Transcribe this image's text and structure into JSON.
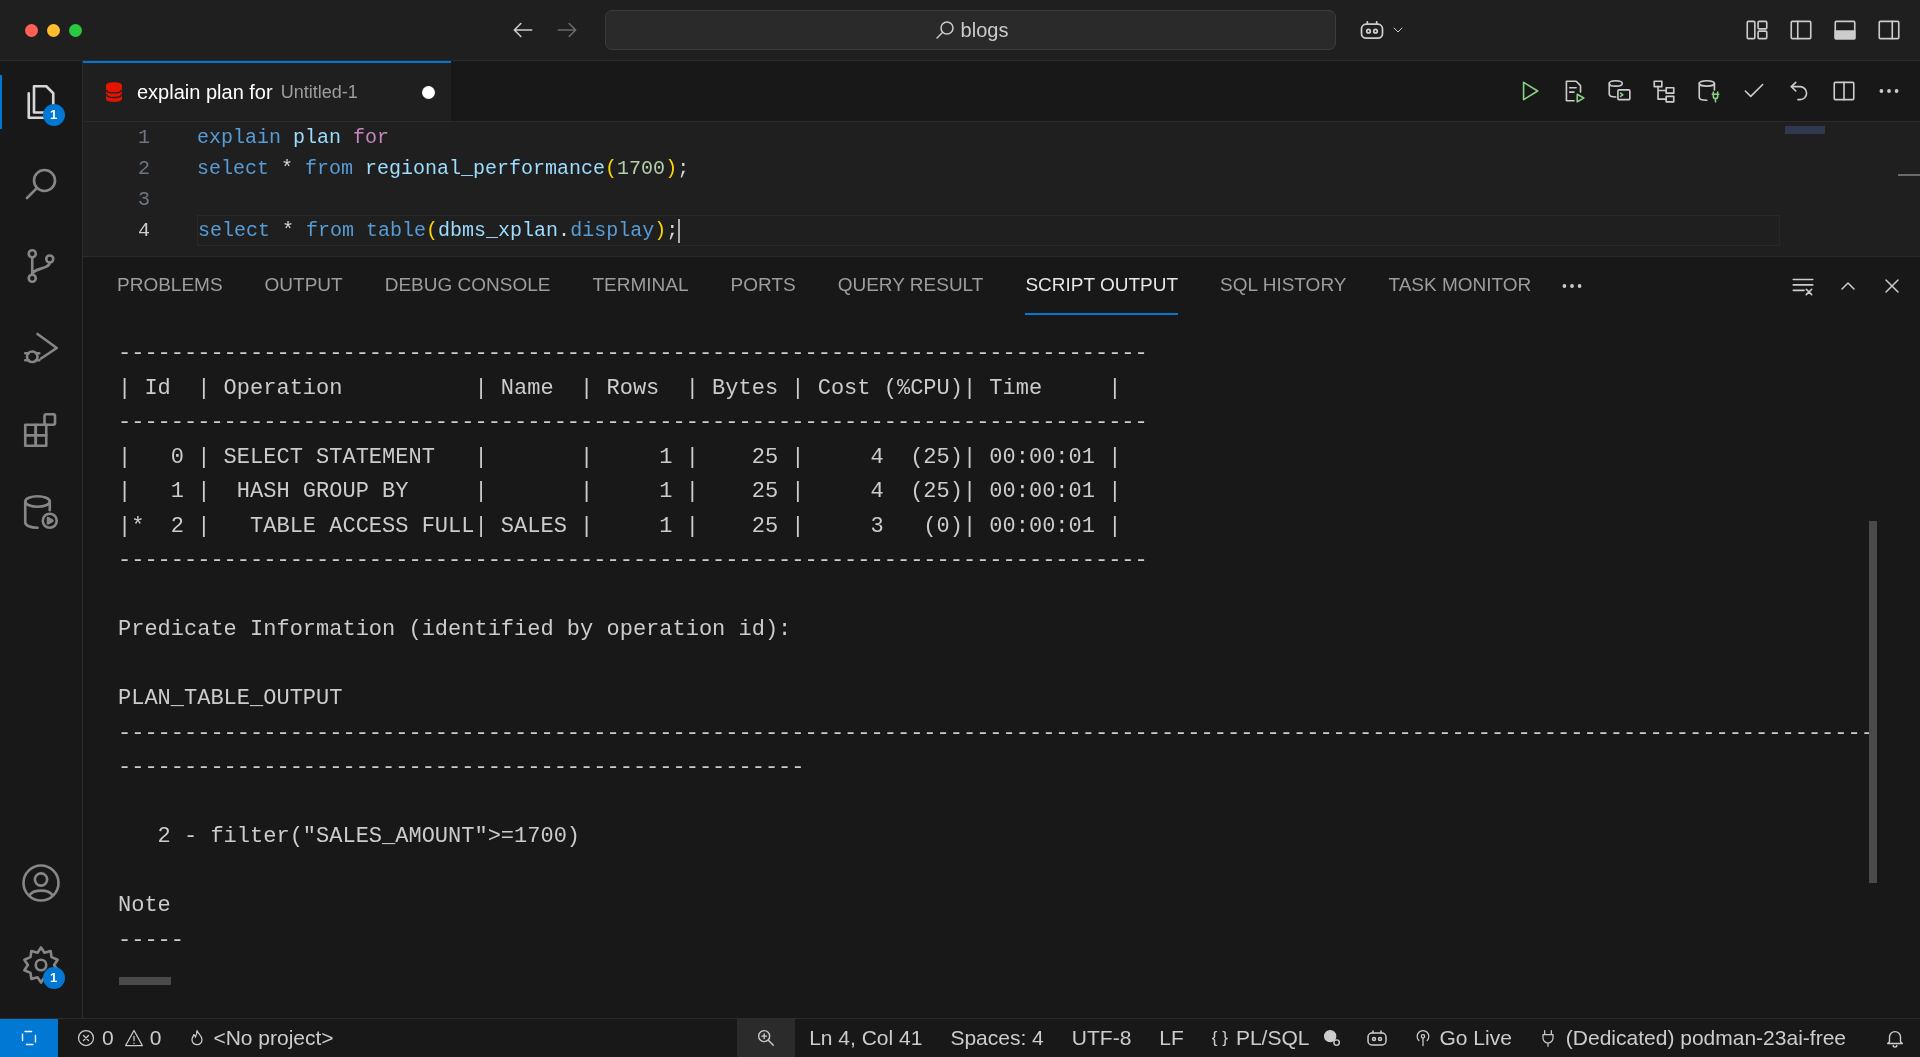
{
  "title_bar": {
    "search": "blogs"
  },
  "activity_bar": {
    "items": [
      {
        "kind": "files",
        "badge": "1",
        "selected": true
      },
      {
        "kind": "search",
        "selected": false
      },
      {
        "kind": "source-control",
        "selected": false
      },
      {
        "kind": "run-debug",
        "selected": false
      },
      {
        "kind": "extensions",
        "selected": false
      },
      {
        "kind": "database",
        "selected": false
      }
    ],
    "bottom": [
      {
        "kind": "account"
      },
      {
        "kind": "settings",
        "badge": "1"
      }
    ]
  },
  "editor_tab": {
    "title": "explain plan for",
    "description": "Untitled-1",
    "dirty": true
  },
  "editor": {
    "lines": [
      {
        "number": "1",
        "current": false,
        "tokens": [
          {
            "kind": "keyword",
            "text": "explain "
          },
          {
            "kind": "ident",
            "text": "plan "
          },
          {
            "kind": "control",
            "text": "for"
          }
        ]
      },
      {
        "number": "2",
        "current": false,
        "tokens": [
          {
            "kind": "keyword",
            "text": "select"
          },
          {
            "kind": "plain",
            "text": " * "
          },
          {
            "kind": "keyword",
            "text": "from "
          },
          {
            "kind": "ident",
            "text": "regional_performance"
          },
          {
            "kind": "bracket",
            "text": "("
          },
          {
            "kind": "number",
            "text": "1700"
          },
          {
            "kind": "bracket",
            "text": ")"
          },
          {
            "kind": "plain",
            "text": ";"
          }
        ]
      },
      {
        "number": "3",
        "current": false
      },
      {
        "number": "4",
        "current": true,
        "tokens": [
          {
            "kind": "keyword",
            "text": "select"
          },
          {
            "kind": "plain",
            "text": " * "
          },
          {
            "kind": "keyword",
            "text": "from table"
          },
          {
            "kind": "bracket",
            "text": "("
          },
          {
            "kind": "ident",
            "text": "dbms_xplan"
          },
          {
            "kind": "plain",
            "text": "."
          },
          {
            "kind": "keyword",
            "text": "display"
          },
          {
            "kind": "bracket",
            "text": ")"
          },
          {
            "kind": "plain",
            "text": ";"
          }
        ]
      }
    ]
  },
  "panel": {
    "tabs": [
      {
        "label": "PROBLEMS",
        "selected": false
      },
      {
        "label": "OUTPUT",
        "selected": false
      },
      {
        "label": "DEBUG CONSOLE",
        "selected": false
      },
      {
        "label": "TERMINAL",
        "selected": false
      },
      {
        "label": "PORTS",
        "selected": false
      },
      {
        "label": "QUERY RESULT",
        "selected": false
      },
      {
        "label": "SCRIPT OUTPUT",
        "selected": true
      },
      {
        "label": "SQL HISTORY",
        "selected": false
      },
      {
        "label": "TASK MONITOR",
        "selected": false
      }
    ],
    "output": [
      {
        "kind": "line",
        "text": "------------------------------------------------------------------------------"
      },
      {
        "kind": "line",
        "text": "| Id  | Operation          | Name  | Rows  | Bytes | Cost (%CPU)| Time     |"
      },
      {
        "kind": "line",
        "text": "------------------------------------------------------------------------------"
      },
      {
        "kind": "line",
        "text": "|   0 | SELECT STATEMENT   |       |     1 |    25 |     4  (25)| 00:00:01 |"
      },
      {
        "kind": "line",
        "text": "|   1 |  HASH GROUP BY     |       |     1 |    25 |     4  (25)| 00:00:01 |"
      },
      {
        "kind": "line",
        "text": "|*  2 |   TABLE ACCESS FULL| SALES |     1 |    25 |     3   (0)| 00:00:01 |"
      },
      {
        "kind": "line",
        "text": "------------------------------------------------------------------------------"
      },
      {
        "kind": "gap"
      },
      {
        "kind": "line",
        "text": "Predicate Information (identified by operation id):"
      },
      {
        "kind": "gap"
      },
      {
        "kind": "line",
        "text": "PLAN_TABLE_OUTPUT"
      },
      {
        "kind": "line",
        "text": "-------------------------------------------------------------------------------------------------------------------------------------"
      },
      {
        "kind": "line",
        "text": "----------------------------------------------------"
      },
      {
        "kind": "gap"
      },
      {
        "kind": "line",
        "text": "   2 - filter(\"SALES_AMOUNT\">=1700)"
      },
      {
        "kind": "gap"
      },
      {
        "kind": "line",
        "text": "Note"
      },
      {
        "kind": "line",
        "text": "-----"
      }
    ]
  },
  "status_bar": {
    "errors": "0",
    "warnings": "0",
    "project": "<No project>",
    "position": "Ln 4, Col 41",
    "spaces": "Spaces: 4",
    "encoding": "UTF-8",
    "eol": "LF",
    "language_icon": "{ }",
    "language": "PL/SQL",
    "live": "Go Live",
    "connection": "(Dedicated) podman-23ai-free"
  }
}
